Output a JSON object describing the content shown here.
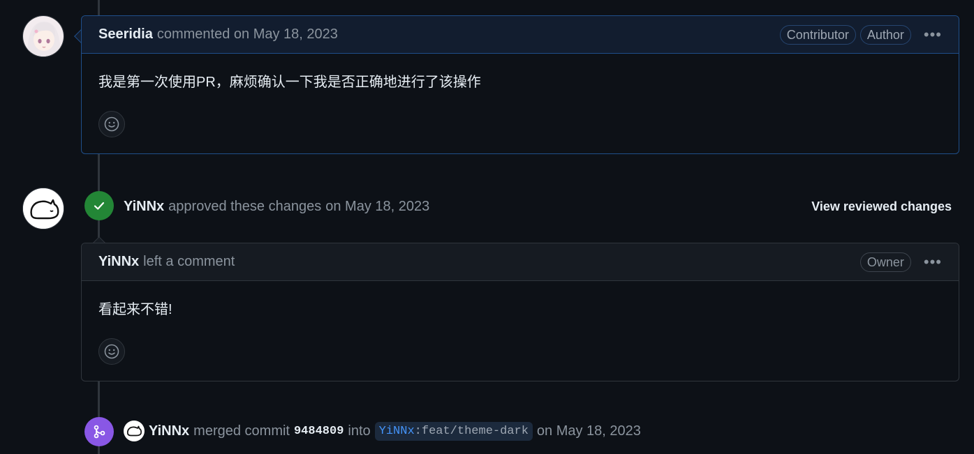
{
  "timeline": {
    "comment1": {
      "author": "Seeridia",
      "action": "commented",
      "date": "on May 18, 2023",
      "badges": [
        "Contributor",
        "Author"
      ],
      "body": "我是第一次使用PR，麻烦确认一下我是否正确地进行了该操作"
    },
    "review": {
      "author": "YiNNx",
      "action": "approved these changes",
      "date": "on May 18, 2023",
      "view_link": "View reviewed changes",
      "comment": {
        "author": "YiNNx",
        "action": "left a comment",
        "badge": "Owner",
        "body": "看起来不错!"
      }
    },
    "merge": {
      "author": "YiNNx",
      "action": "merged commit",
      "sha": "9484809",
      "into": "into",
      "branch_owner": "YiNNx",
      "branch_sep": ":",
      "branch_name": "feat/theme-dark",
      "date": "on May 18, 2023"
    }
  },
  "icons": {
    "more": "kebab-horizontal-icon",
    "reaction": "smiley-icon",
    "approved": "check-icon",
    "merged": "git-merge-icon"
  },
  "colors": {
    "background": "#0d1117",
    "approve_green": "#238636",
    "merge_purple": "#8957e5",
    "author_border": "#1f4f8b",
    "link_blue": "#4493f8"
  }
}
